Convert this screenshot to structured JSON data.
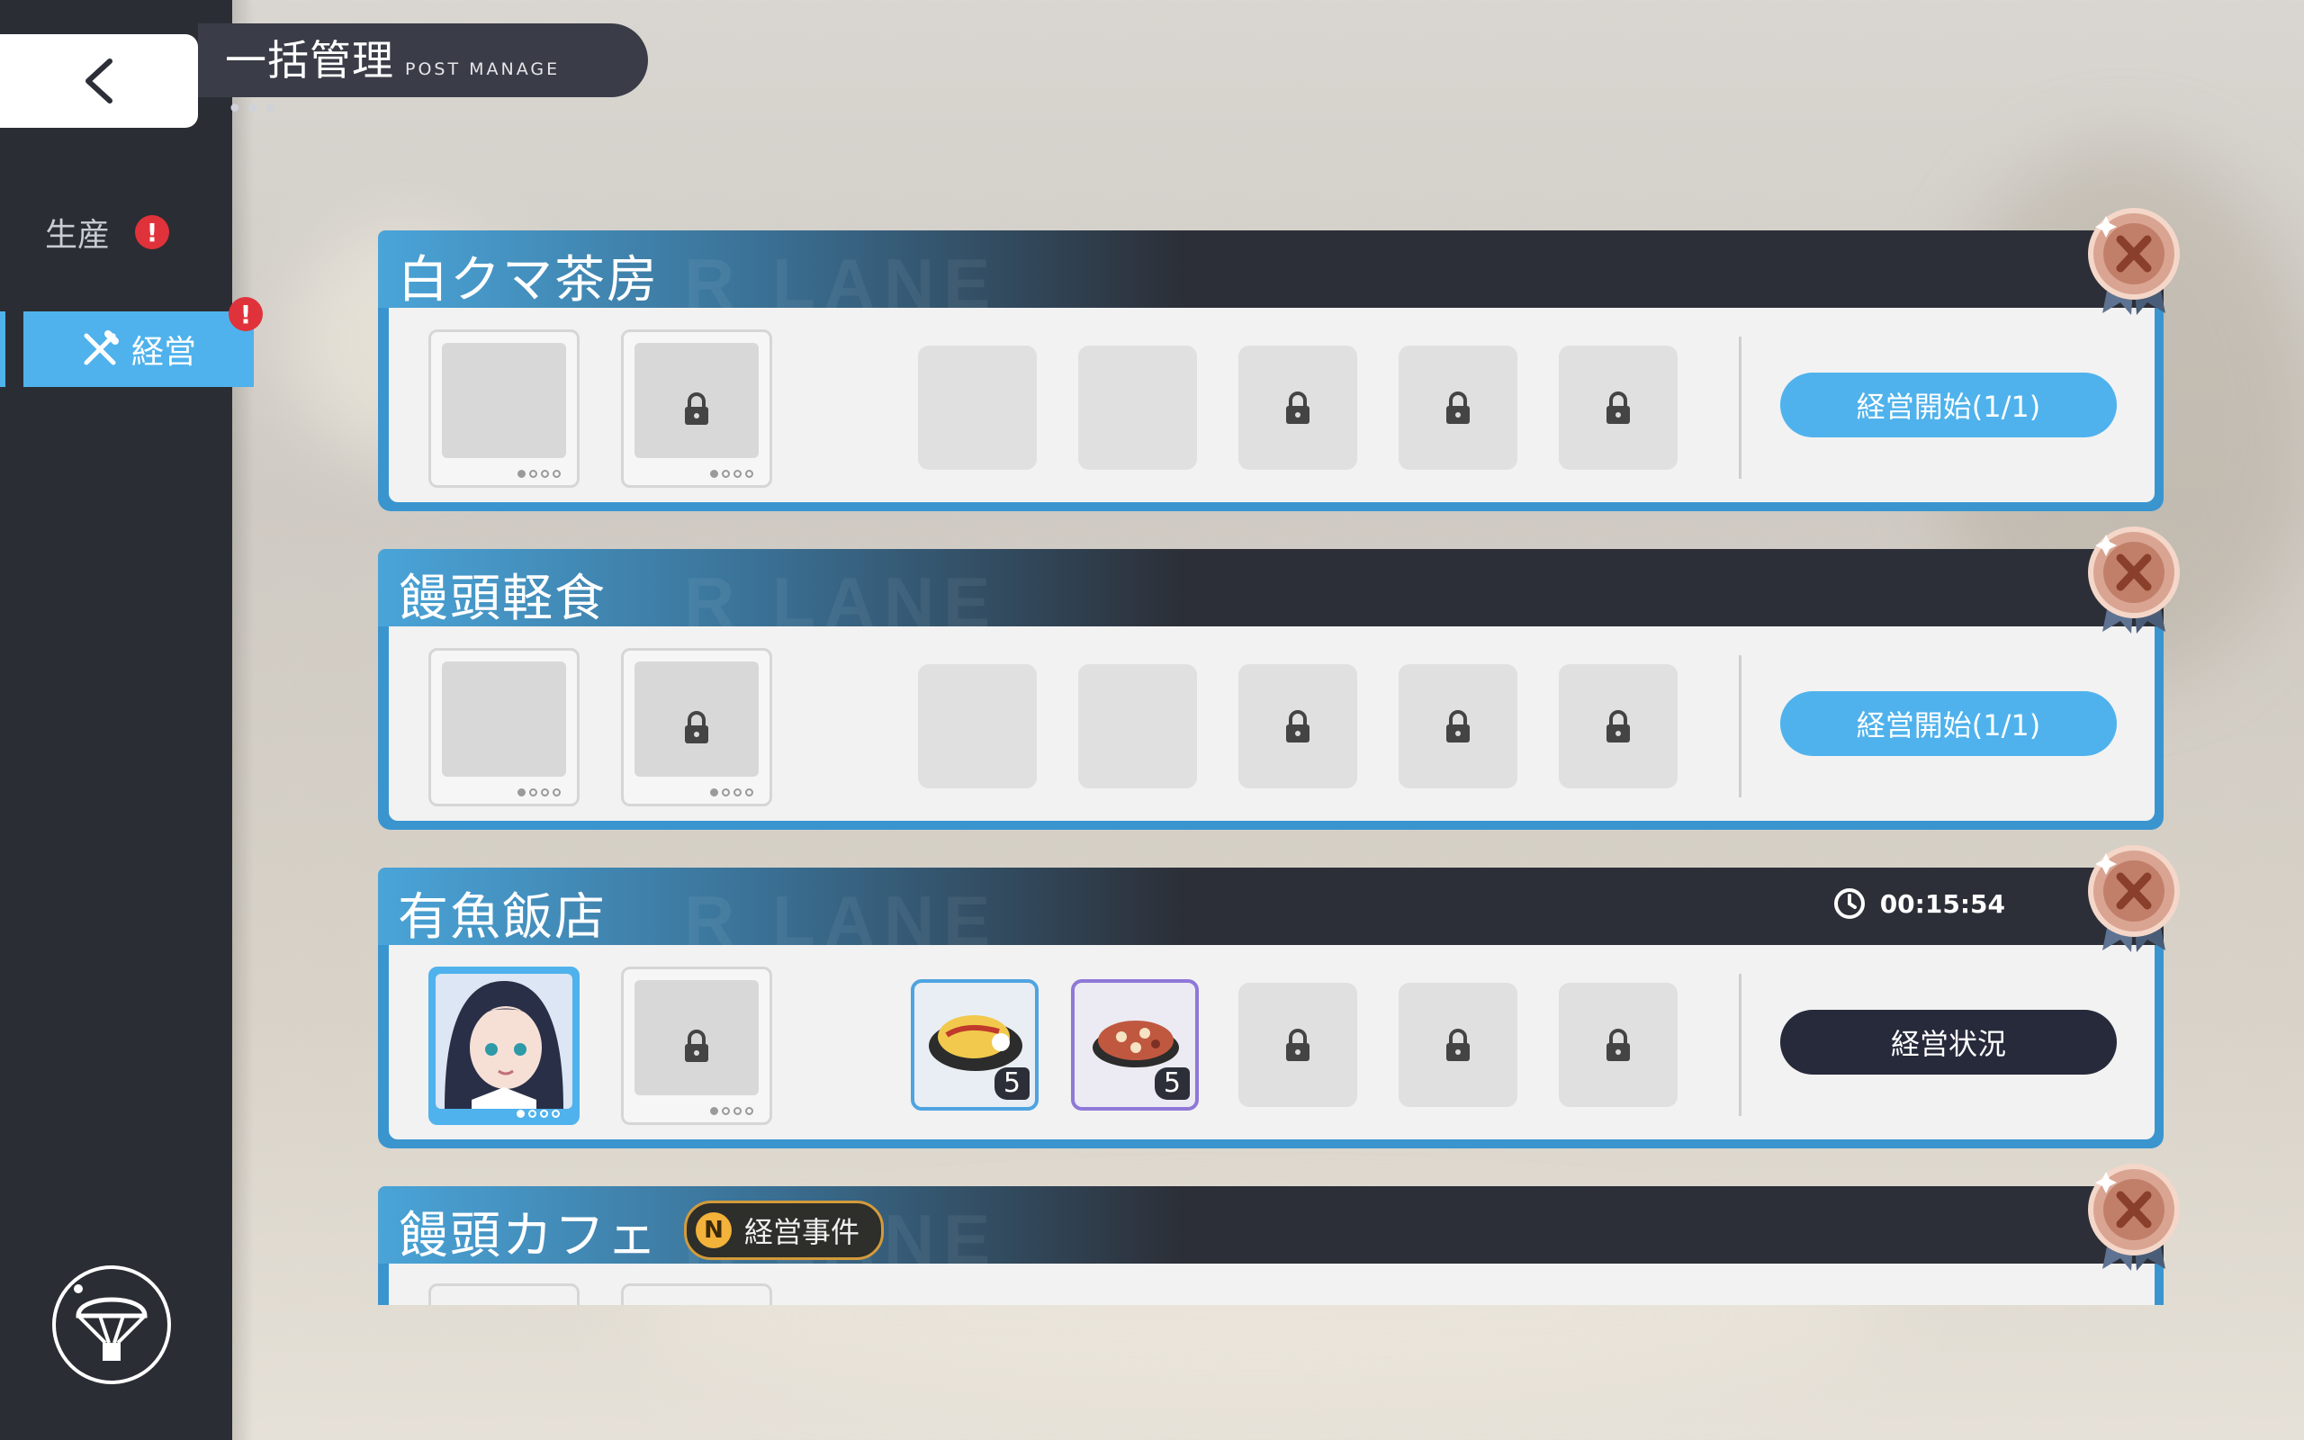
{
  "header": {
    "title": "一括管理",
    "subtitle": "POST MANAGE",
    "dots": "•••"
  },
  "sidebar": {
    "items": [
      {
        "label": "生産",
        "alert": "!"
      },
      {
        "label": "経営",
        "alert": "!",
        "active": true
      }
    ]
  },
  "watermark": "R LANE",
  "cards": [
    {
      "name": "白クマ茶房",
      "button": "経営開始(1/1)",
      "button_style": "start"
    },
    {
      "name": "饅頭軽食",
      "button": "経営開始(1/1)",
      "button_style": "start"
    },
    {
      "name": "有魚飯店",
      "button": "経営状況",
      "button_style": "status",
      "timer": "00:15:54",
      "items": [
        {
          "icon": "omelette-icon",
          "count": "5"
        },
        {
          "icon": "pizza-icon",
          "count": "5"
        }
      ]
    },
    {
      "name": "饅頭カフェ",
      "event": {
        "tag": "N",
        "label": "経営事件"
      }
    }
  ],
  "colors": {
    "accent": "#4fb2ec",
    "dark": "#2c2f37",
    "alert": "#e0323a",
    "event_border": "#d39b3a"
  }
}
